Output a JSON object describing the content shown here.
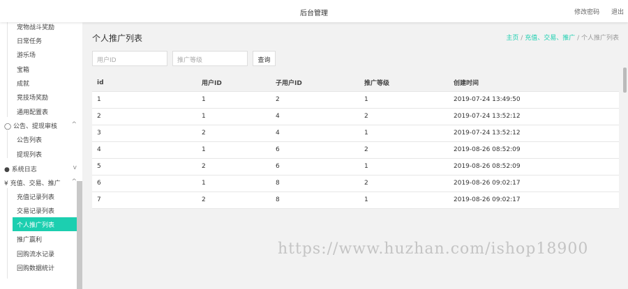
{
  "header": {
    "title": "后台管理",
    "change_password": "修改密码",
    "logout": "退出"
  },
  "sidebar": {
    "items_top": [
      "宠物战斗奖励",
      "日常任务",
      "游乐场",
      "宝箱",
      "成就",
      "竞技场奖励",
      "通用配置表"
    ],
    "group_notice": {
      "label": "公告、提现审核",
      "icon": "chat-icon",
      "chev": "^",
      "items": [
        "公告列表",
        "提现列表"
      ]
    },
    "group_log": {
      "label": "系统日志",
      "icon": "android-icon",
      "chev": "v"
    },
    "group_pay": {
      "label": "充值、交易、推广",
      "icon": "yen-icon",
      "chev": "^",
      "items": [
        "充值记录列表",
        "交易记录列表",
        "个人推广列表",
        "推广赢利",
        "回购流水记录",
        "回购数据统计"
      ]
    }
  },
  "main": {
    "title": "个人推广列表",
    "breadcrumb": [
      "主页",
      "充值、交易、推广",
      "个人推广列表"
    ],
    "search": {
      "user_id_placeholder": "用户ID",
      "level_placeholder": "推广等级",
      "button": "查询"
    },
    "table": {
      "headers": [
        "id",
        "用户ID",
        "子用户ID",
        "推广等级",
        "创建时间"
      ],
      "rows": [
        [
          "1",
          "1",
          "2",
          "1",
          "2019-07-24 13:49:50"
        ],
        [
          "2",
          "1",
          "4",
          "2",
          "2019-07-24 13:52:12"
        ],
        [
          "3",
          "2",
          "4",
          "1",
          "2019-07-24 13:52:12"
        ],
        [
          "4",
          "1",
          "6",
          "2",
          "2019-08-26 08:52:09"
        ],
        [
          "5",
          "2",
          "6",
          "1",
          "2019-08-26 08:52:09"
        ],
        [
          "6",
          "1",
          "8",
          "2",
          "2019-08-26 09:02:17"
        ],
        [
          "7",
          "2",
          "8",
          "1",
          "2019-08-26 09:02:17"
        ]
      ]
    }
  },
  "watermark": "https://www.huzhan.com/ishop18900"
}
